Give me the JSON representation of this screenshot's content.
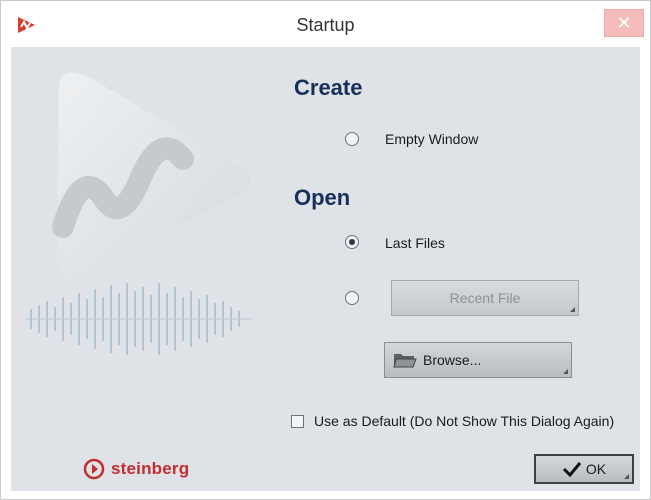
{
  "window": {
    "title": "Startup",
    "close_glyph": "✕"
  },
  "create": {
    "heading": "Create",
    "empty_window_label": "Empty Window",
    "empty_window_selected": false
  },
  "open": {
    "heading": "Open",
    "last_files_label": "Last Files",
    "last_files_selected": true,
    "recent_file_label": "Recent File",
    "recent_file_selected": false,
    "browse_label": "Browse..."
  },
  "default_checkbox": {
    "label": "Use as Default (Do Not Show This Dialog Again)",
    "checked": false
  },
  "ok_label": "OK",
  "brand": {
    "logo_text": "steinberg",
    "color": "#c42d2d"
  },
  "icons": {
    "app": "wavelab-app-icon",
    "close": "close-icon",
    "folder": "folder-icon",
    "check": "checkmark-icon",
    "logo": "steinberg-logo-icon"
  }
}
